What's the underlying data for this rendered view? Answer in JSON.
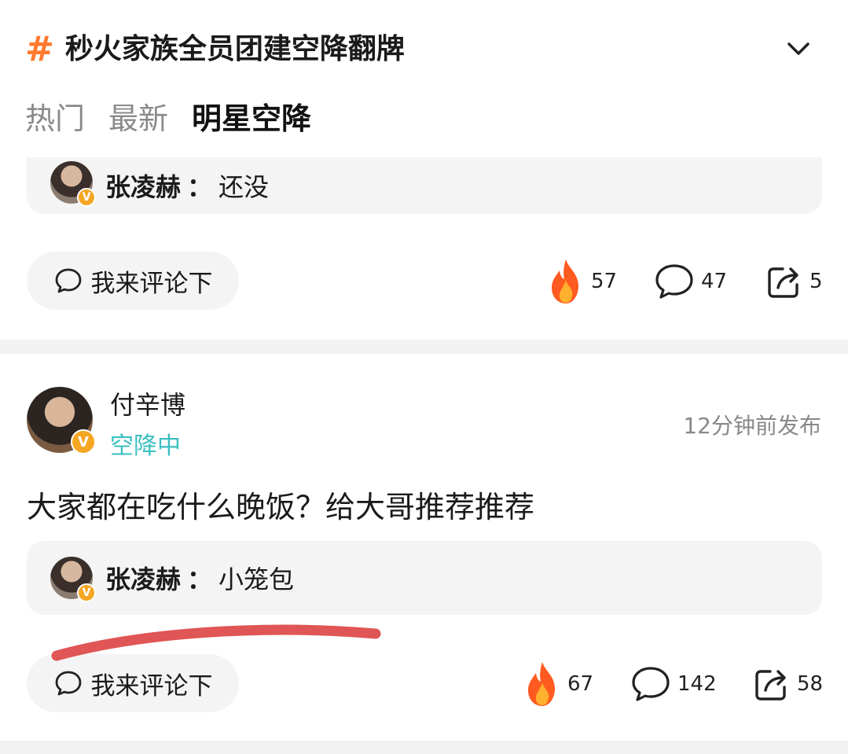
{
  "topic": {
    "hash_symbol": "#",
    "title": "秒火家族全员团建空降翻牌"
  },
  "tabs": [
    {
      "label": "热门",
      "active": false
    },
    {
      "label": "最新",
      "active": false
    },
    {
      "label": "明星空降",
      "active": true
    }
  ],
  "post1": {
    "reply": {
      "name": "张凌赫",
      "colon": "：",
      "text": "还没"
    },
    "comment_button": "我来评论下",
    "likes": "57",
    "comments": "47",
    "shares": "5"
  },
  "post2": {
    "author": "付辛博",
    "status": "空降中",
    "time": "12分钟前发布",
    "text": "大家都在吃什么晚饭？给大哥推荐推荐",
    "reply": {
      "name": "张凌赫",
      "colon": "：",
      "text": "小笼包"
    },
    "comment_button": "我来评论下",
    "likes": "67",
    "comments": "142",
    "shares": "58"
  },
  "badge_letter": "V",
  "colors": {
    "accent_orange": "#ff7a2f",
    "status_teal": "#3bbfc2",
    "badge": "#f5a623",
    "annotation_red": "#e05555"
  },
  "icons": [
    "hash-icon",
    "chevron-down-icon",
    "comment-bubble-icon",
    "fire-icon",
    "share-icon",
    "verified-badge-icon"
  ]
}
